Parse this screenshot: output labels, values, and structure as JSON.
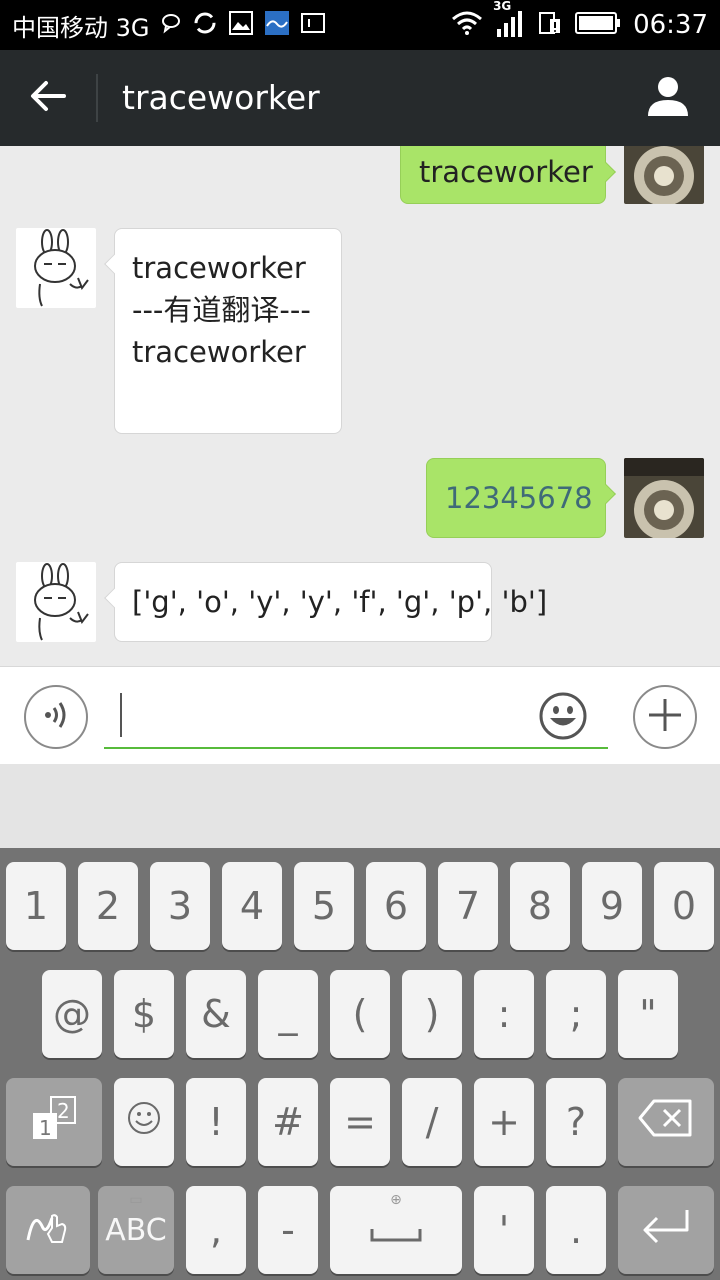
{
  "status_bar": {
    "carrier": "中国移动 3G",
    "network": "3G",
    "time": "06:37"
  },
  "header": {
    "title": "traceworker",
    "back_icon": "back-arrow-icon",
    "profile_icon": "person-icon"
  },
  "messages": [
    {
      "direction": "sent",
      "text": "traceworker"
    },
    {
      "direction": "received",
      "text": "traceworker\n---有道翻译---\ntraceworker"
    },
    {
      "direction": "sent",
      "text": "12345678"
    },
    {
      "direction": "received",
      "text": "['g', 'o', 'y', 'y', 'f', 'g', 'p', 'b']"
    }
  ],
  "input_bar": {
    "voice_icon": "voice-icon",
    "emoji_icon": "emoji-icon",
    "plus_icon": "plus-icon",
    "value": ""
  },
  "colors": {
    "title_bar": "#262a2c",
    "sent_bubble": "#a9e468",
    "received_bubble": "#ffffff",
    "input_underline": "#57bb3b"
  },
  "keyboard": {
    "row1": [
      "1",
      "2",
      "3",
      "4",
      "5",
      "6",
      "7",
      "8",
      "9",
      "0"
    ],
    "row2": [
      "@",
      "$",
      "&",
      "_",
      "(",
      ")",
      ":",
      ";",
      "\""
    ],
    "row3": [
      "!",
      "#",
      "=",
      "/",
      "+",
      "?"
    ],
    "row4": [
      "ABC",
      ",",
      "-",
      "'",
      "."
    ],
    "keys_icons": {
      "symbol_page": "page-1-2-icon",
      "emoticon": "smiley-icon",
      "backspace": "backspace-icon",
      "handwriting": "handwriting-icon",
      "space": "space-bar-icon",
      "enter": "enter-icon",
      "globe": "globe-icon"
    }
  }
}
